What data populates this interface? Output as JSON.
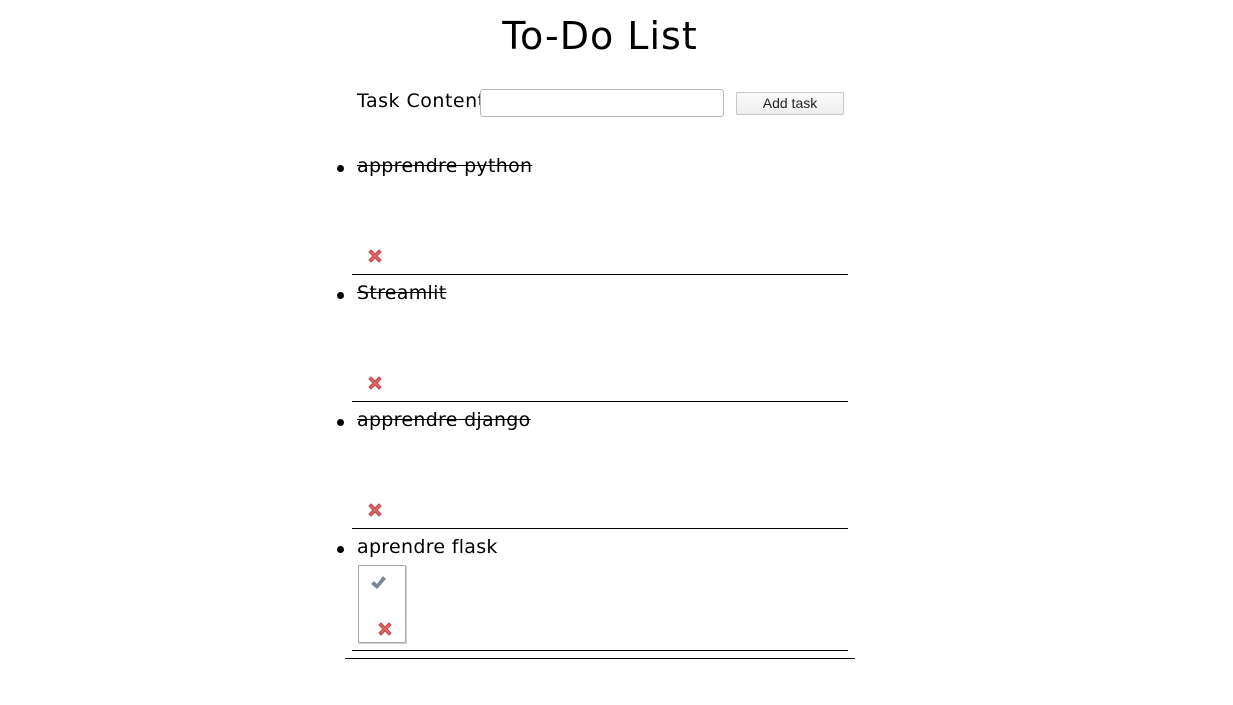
{
  "title": "To-Do List",
  "form": {
    "label": "Task Content:",
    "input_value": "",
    "button_label": "Add task"
  },
  "tasks": [
    {
      "text": "apprendre python",
      "completed": true
    },
    {
      "text": "Streamlit",
      "completed": true
    },
    {
      "text": "apprendre django",
      "completed": true
    },
    {
      "text": "aprendre flask",
      "completed": false
    }
  ],
  "icons": {
    "delete": "delete-cross-icon",
    "complete": "checkmark-icon"
  },
  "colors": {
    "delete_red": "#d9534f",
    "check_gray": "#7a8694"
  }
}
